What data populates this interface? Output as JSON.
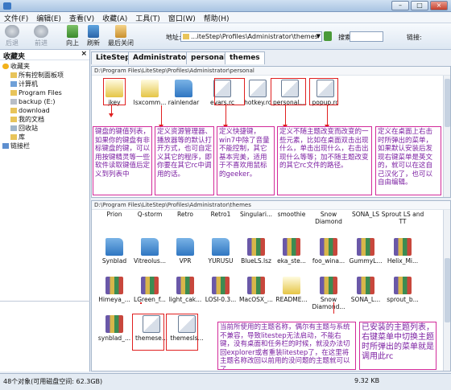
{
  "window": {
    "title": ""
  },
  "menu": [
    "文件(F)",
    "编辑(E)",
    "查看(V)",
    "收藏(A)",
    "工具(T)",
    "窗口(W)",
    "帮助(H)"
  ],
  "toolbar": {
    "back": "后退",
    "forward": "前进",
    "up": "向上",
    "refresh": "刷新",
    "recent": "最后关闭",
    "address_label": "地址:",
    "address_value": "...iteStep\\Profiles\\Administrator\\themes",
    "search_label": "搜索",
    "links_label": "链接:"
  },
  "favorites": {
    "title": "收藏夹",
    "close": "×",
    "items": [
      {
        "label": "收藏夹",
        "icon": "star-icon"
      },
      {
        "label": "所有控制面板项",
        "icon": "folder-icon"
      },
      {
        "label": "计算机",
        "icon": "computer-icon"
      },
      {
        "label": "Program Files",
        "icon": "folder-icon"
      },
      {
        "label": "backup (E:)",
        "icon": "drive-icon"
      },
      {
        "label": "download",
        "icon": "folder-icon"
      },
      {
        "label": "我的文档",
        "icon": "folder-icon"
      },
      {
        "label": "回收站",
        "icon": "trash-icon"
      },
      {
        "label": "库",
        "icon": "folder-icon"
      },
      {
        "label": "链接栏",
        "icon": "link-icon"
      }
    ]
  },
  "tabs": [
    "LiteStep",
    "Administrator",
    "personal",
    "themes"
  ],
  "top_pane": {
    "path": "D:\\Program Files\\LiteStep\\Profiles\\Administrator\\personal",
    "files": [
      "jkey",
      "lsxcomm...",
      "rainlendar",
      "evars.rc",
      "hotkey.rc",
      "personal....",
      "popup.rc"
    ]
  },
  "bottom_pane": {
    "path": "D:\\Program Files\\LiteStep\\Profiles\\Administrator\\themes",
    "rows": [
      [
        "Prion",
        "Q-storm",
        "Retro",
        "Retro1",
        "Singulari...",
        "smoothie",
        "Snow Diamond",
        "SONA_LS",
        "Sprout LS and TT"
      ],
      [
        "Synblad",
        "Vitreolus...",
        "VPR",
        "YURUSU",
        "BlueLS.lsz",
        "eka_ste...",
        "foo_wina...",
        "GummyL...",
        "Helix_Mi..."
      ],
      [
        "Himeya_...",
        "LGreen_f...",
        "light_cak...",
        "LOSI-0.3...",
        "MacOSX_...",
        "README...",
        "Snow Diamond...",
        "SONA_L...",
        "sprout_b..."
      ],
      [
        "synblad_...",
        "themese...",
        "themesls..."
      ]
    ]
  },
  "notes": {
    "jkey": "键盘的键值列表，如果你的键盘有非标键盘的键，可以用按键精灵等一些软件读取键值后定义到列表中",
    "lsxcomm": "定义资源管理器、播放器等的默认打开方式，也可自定义其它的程序，即你要在其它rc中调用的话。",
    "hotkey": "定义快捷键，win7中除了音量不能控制，其它基本完美，适用于不喜欢用鼠标的geeker。",
    "personal": "定义不随主题改变而改变的一些元素，比如在桌面双击出现什么，单击出现什么，右击出现什么等等；加不随主题改变的其它rc文件的路径。",
    "popup": "定义在桌面上右击时所弹出的菜单，如果默认安装后发现右键菜单是英文的，就可以在这自己汉化了，也可以自由编辑。",
    "themes_current": "当前所使用的主题名称，偶尔有主题与系统不兼容，导致litestep无法启动，不能右键，没有桌面和任务栏的时候，就没办法切回explorer或者重装litestep了，在这里将主题名称改回以前用的没问题的主题就可以了。",
    "themes_list": "已安装的主题列表，右键菜单中切换主题时所弹出的菜单就是调用此rc"
  },
  "status": {
    "left": "48个对象(可用磁盘空间: 62.3GB)",
    "right": "9.32 KB"
  }
}
